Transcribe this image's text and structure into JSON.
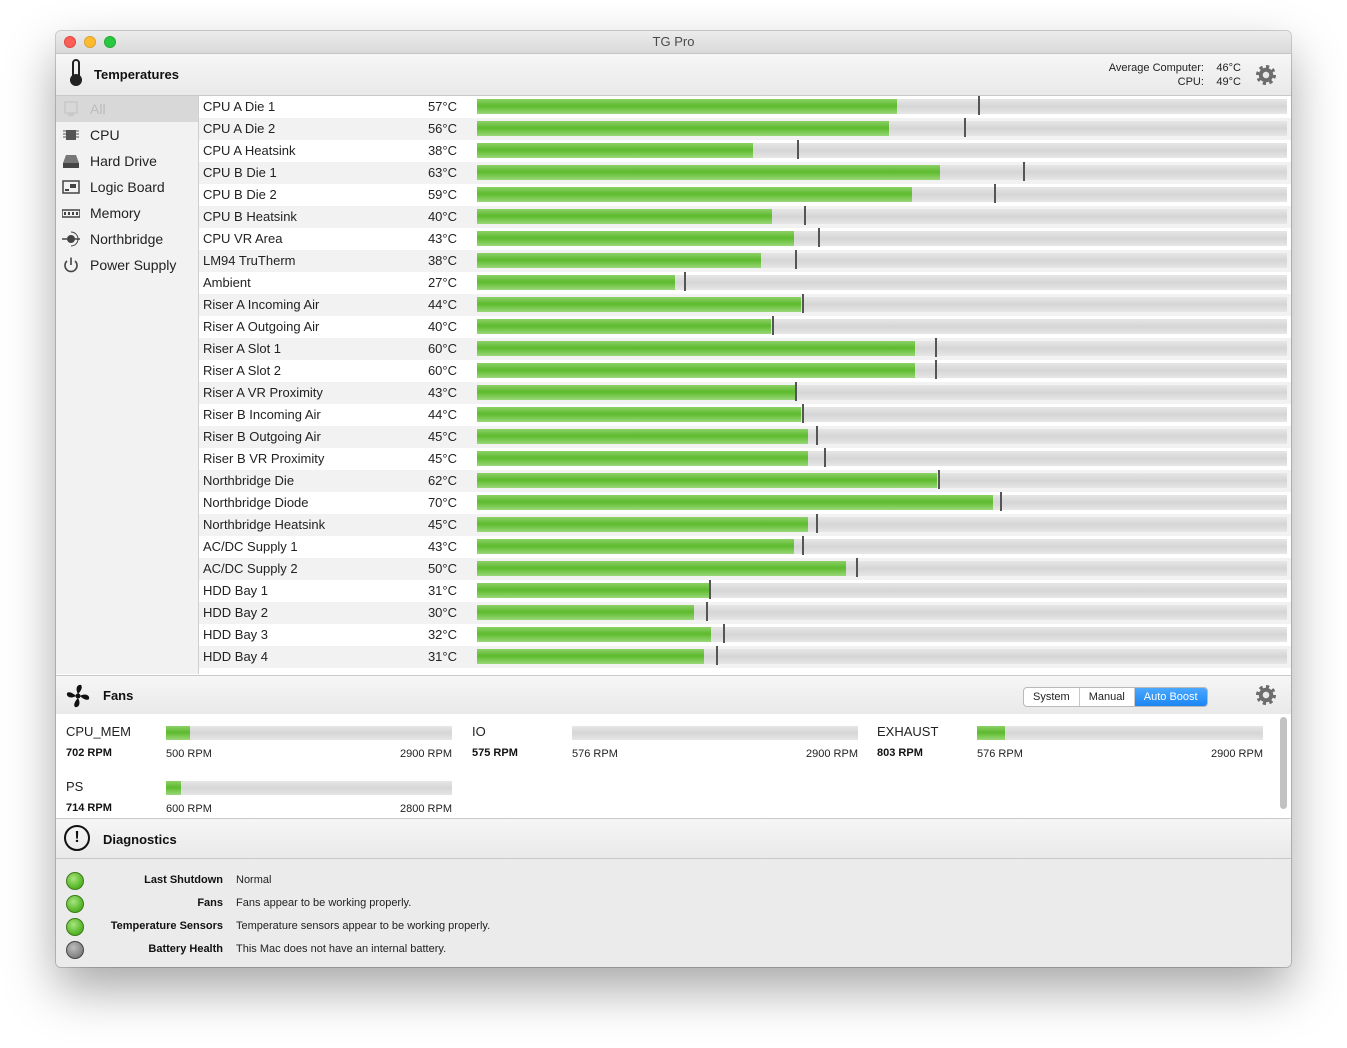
{
  "window": {
    "title": "TG Pro"
  },
  "temperatures": {
    "title": "Temperatures",
    "average_label": "Average Computer:",
    "average_value": "46°C",
    "cpu_label": "CPU:",
    "cpu_value": "49°C"
  },
  "sidebar": {
    "items": [
      {
        "label": "All",
        "icon": "all-icon"
      },
      {
        "label": "CPU",
        "icon": "cpu-chip-icon"
      },
      {
        "label": "Hard Drive",
        "icon": "hard-drive-icon"
      },
      {
        "label": "Logic Board",
        "icon": "logic-board-icon"
      },
      {
        "label": "Memory",
        "icon": "memory-icon"
      },
      {
        "label": "Northbridge",
        "icon": "northbridge-icon"
      },
      {
        "label": "Power Supply",
        "icon": "power-icon"
      }
    ]
  },
  "sensors": [
    {
      "name": "CPU A Die 1",
      "temp": "57°C",
      "fill": 0.518,
      "max": 0.619
    },
    {
      "name": "CPU A Die 2",
      "temp": "56°C",
      "fill": 0.509,
      "max": 0.601
    },
    {
      "name": "CPU A Heatsink",
      "temp": "38°C",
      "fill": 0.341,
      "max": 0.395
    },
    {
      "name": "CPU B Die 1",
      "temp": "63°C",
      "fill": 0.572,
      "max": 0.674
    },
    {
      "name": "CPU B Die 2",
      "temp": "59°C",
      "fill": 0.537,
      "max": 0.638
    },
    {
      "name": "CPU B Heatsink",
      "temp": "40°C",
      "fill": 0.364,
      "max": 0.404
    },
    {
      "name": "CPU VR Area",
      "temp": "43°C",
      "fill": 0.391,
      "max": 0.421
    },
    {
      "name": "LM94 TruTherm",
      "temp": "38°C",
      "fill": 0.35,
      "max": 0.392
    },
    {
      "name": "Ambient",
      "temp": "27°C",
      "fill": 0.244,
      "max": 0.256
    },
    {
      "name": "Riser A Incoming Air",
      "temp": "44°C",
      "fill": 0.4,
      "max": 0.401
    },
    {
      "name": "Riser A Outgoing Air",
      "temp": "40°C",
      "fill": 0.363,
      "max": 0.364
    },
    {
      "name": "Riser A Slot 1",
      "temp": "60°C",
      "fill": 0.541,
      "max": 0.565
    },
    {
      "name": "Riser A Slot 2",
      "temp": "60°C",
      "fill": 0.541,
      "max": 0.565
    },
    {
      "name": "Riser A VR Proximity",
      "temp": "43°C",
      "fill": 0.392,
      "max": 0.393
    },
    {
      "name": "Riser B Incoming Air",
      "temp": "44°C",
      "fill": 0.4,
      "max": 0.401
    },
    {
      "name": "Riser B Outgoing Air",
      "temp": "45°C",
      "fill": 0.409,
      "max": 0.419
    },
    {
      "name": "Riser B VR Proximity",
      "temp": "45°C",
      "fill": 0.409,
      "max": 0.428
    },
    {
      "name": "Northbridge Die",
      "temp": "62°C",
      "fill": 0.568,
      "max": 0.569
    },
    {
      "name": "Northbridge Diode",
      "temp": "70°C",
      "fill": 0.637,
      "max": 0.646
    },
    {
      "name": "Northbridge Heatsink",
      "temp": "45°C",
      "fill": 0.409,
      "max": 0.419
    },
    {
      "name": "AC/DC Supply 1",
      "temp": "43°C",
      "fill": 0.391,
      "max": 0.401
    },
    {
      "name": "AC/DC Supply 2",
      "temp": "50°C",
      "fill": 0.455,
      "max": 0.468
    },
    {
      "name": "HDD Bay 1",
      "temp": "31°C",
      "fill": 0.286,
      "max": 0.287
    },
    {
      "name": "HDD Bay 2",
      "temp": "30°C",
      "fill": 0.268,
      "max": 0.283
    },
    {
      "name": "HDD Bay 3",
      "temp": "32°C",
      "fill": 0.289,
      "max": 0.304
    },
    {
      "name": "HDD Bay 4",
      "temp": "31°C",
      "fill": 0.28,
      "max": 0.295
    }
  ],
  "fans": {
    "title": "Fans",
    "modes": [
      "System",
      "Manual",
      "Auto Boost"
    ],
    "active_mode": "Auto Boost",
    "items": [
      {
        "name": "CPU_MEM",
        "rpm": "702 RPM",
        "min": "500 RPM",
        "max": "2900 RPM",
        "fill": 0.084
      },
      {
        "name": "IO",
        "rpm": "575 RPM",
        "min": "576 RPM",
        "max": "2900 RPM",
        "fill": 0.0
      },
      {
        "name": "EXHAUST",
        "rpm": "803 RPM",
        "min": "576 RPM",
        "max": "2900 RPM",
        "fill": 0.098
      },
      {
        "name": "PS",
        "rpm": "714 RPM",
        "min": "600 RPM",
        "max": "2800 RPM",
        "fill": 0.052
      }
    ]
  },
  "diagnostics": {
    "title": "Diagnostics",
    "items": [
      {
        "label": "Last Shutdown",
        "value": "Normal",
        "status": "ok"
      },
      {
        "label": "Fans",
        "value": "Fans appear to be working properly.",
        "status": "ok"
      },
      {
        "label": "Temperature Sensors",
        "value": "Temperature sensors appear to be working properly.",
        "status": "ok"
      },
      {
        "label": "Battery Health",
        "value": "This Mac does not have an internal battery.",
        "status": "none"
      }
    ]
  },
  "colors": {
    "bar_green": "#5dba2f",
    "accent_blue": "#1a85f2"
  }
}
